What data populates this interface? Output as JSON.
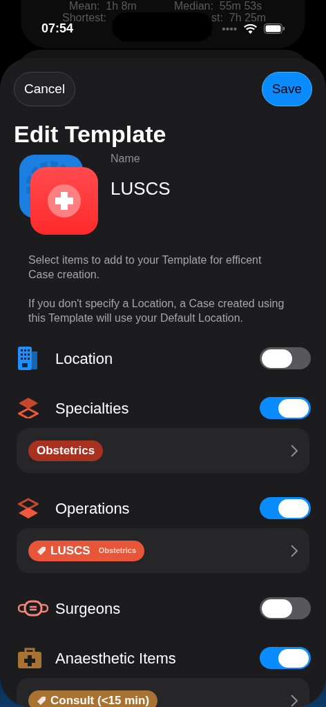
{
  "status_bar": {
    "time": "07:54"
  },
  "background_stats": [
    "Mean:  1h 8m",
    "Median:  55m 53s",
    "Shortest:",
    "st:  7h 25m"
  ],
  "nav": {
    "cancel": "Cancel",
    "save": "Save"
  },
  "title": "Edit Template",
  "name_field": {
    "label": "Name",
    "value": "LUSCS"
  },
  "description": [
    "Select items to add to your Template for efficent Case creation.",
    "If you don't specify a Location, a Case created using this Template will use your Default Location."
  ],
  "sections": [
    {
      "kind": "location",
      "label": "Location",
      "on": false
    },
    {
      "kind": "specialties",
      "label": "Specialties",
      "on": true,
      "tags": [
        {
          "kind": "plain",
          "label": "Obstetrics",
          "color": "#a8321f"
        }
      ]
    },
    {
      "kind": "operations",
      "label": "Operations",
      "on": true,
      "tags": [
        {
          "kind": "tagged",
          "label": "LUSCS",
          "sublabel": "Obstetrics",
          "color": "#e8563a"
        }
      ]
    },
    {
      "kind": "surgeons",
      "label": "Surgeons",
      "on": false
    },
    {
      "kind": "items",
      "label": "Anaesthetic Items",
      "on": true,
      "tags": [
        {
          "kind": "tagged",
          "label": "Consult (<15 min)",
          "color": "#a87332"
        }
      ]
    }
  ]
}
